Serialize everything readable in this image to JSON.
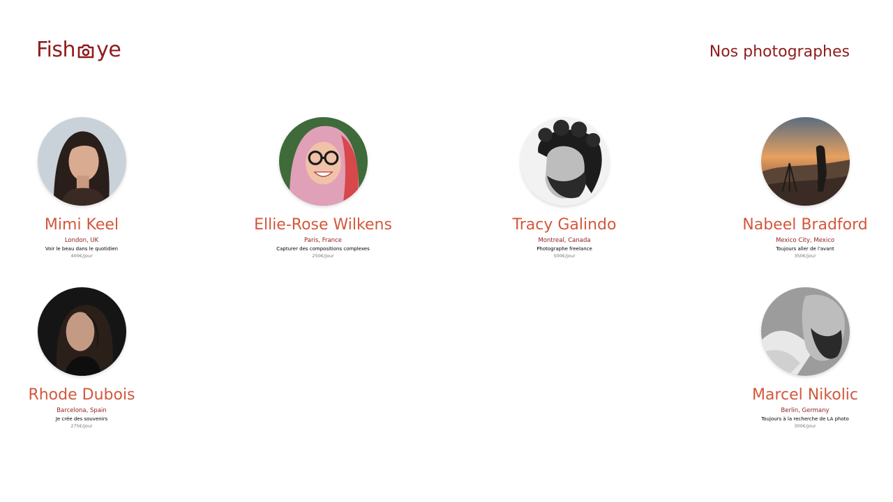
{
  "header": {
    "logo_text_left": "Fish",
    "logo_text_right": "ye",
    "logo_icon": "camera-icon",
    "title": "Nos photographes"
  },
  "colors": {
    "primary": "#901c1c",
    "secondary": "#d3573c",
    "muted": "#757575"
  },
  "photographers": [
    {
      "name": "Mimi Keel",
      "location": "London, UK",
      "tagline": "Voir le beau dans le quotidien",
      "price": "400€/jour"
    },
    {
      "name": "Ellie-Rose Wilkens",
      "location": "Paris, France",
      "tagline": "Capturer des compositions complexes",
      "price": "250€/jour"
    },
    {
      "name": "Tracy Galindo",
      "location": "Montreal, Canada",
      "tagline": "Photographe freelance",
      "price": "500€/jour"
    },
    {
      "name": "Nabeel Bradford",
      "location": "Mexico City, Mexico",
      "tagline": "Toujours aller de l'avant",
      "price": "350€/jour"
    },
    {
      "name": "Rhode Dubois",
      "location": "Barcelona, Spain",
      "tagline": "Je crée des souvenirs",
      "price": "275€/jour"
    },
    {
      "name": "Marcel Nikolic",
      "location": "Berlin, Germany",
      "tagline": "Toujours à la recherche de LA photo",
      "price": "300€/jour"
    }
  ]
}
